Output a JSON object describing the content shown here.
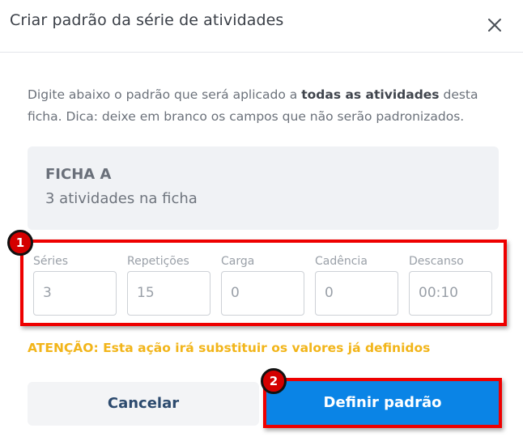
{
  "dialog": {
    "title": "Criar padrão da série de atividades",
    "close_icon": "close-icon"
  },
  "intro": {
    "text_before": "Digite abaixo o padrão que será aplicado a ",
    "text_bold": "todas as atividades",
    "text_after": " desta ficha. Dica: deixe em branco os campos que não serão padronizados."
  },
  "card": {
    "title": "FICHA A",
    "subtitle": "3 atividades na ficha"
  },
  "fields": [
    {
      "label": "Séries",
      "value": "3"
    },
    {
      "label": "Repetições",
      "value": "15"
    },
    {
      "label": "Carga",
      "value": "0"
    },
    {
      "label": "Cadência",
      "value": "0"
    },
    {
      "label": "Descanso",
      "value": "00:10"
    }
  ],
  "warning": "ATENÇÃO: Esta ação irá substituir os valores já definidos",
  "buttons": {
    "cancel": "Cancelar",
    "confirm": "Definir padrão"
  },
  "annotations": {
    "badge_1": "1",
    "badge_2": "2",
    "highlight_color": "#ee0000"
  },
  "colors": {
    "primary": "#0a84e6",
    "warning": "#f2b51a",
    "cancel_text": "#2c4a6e"
  }
}
